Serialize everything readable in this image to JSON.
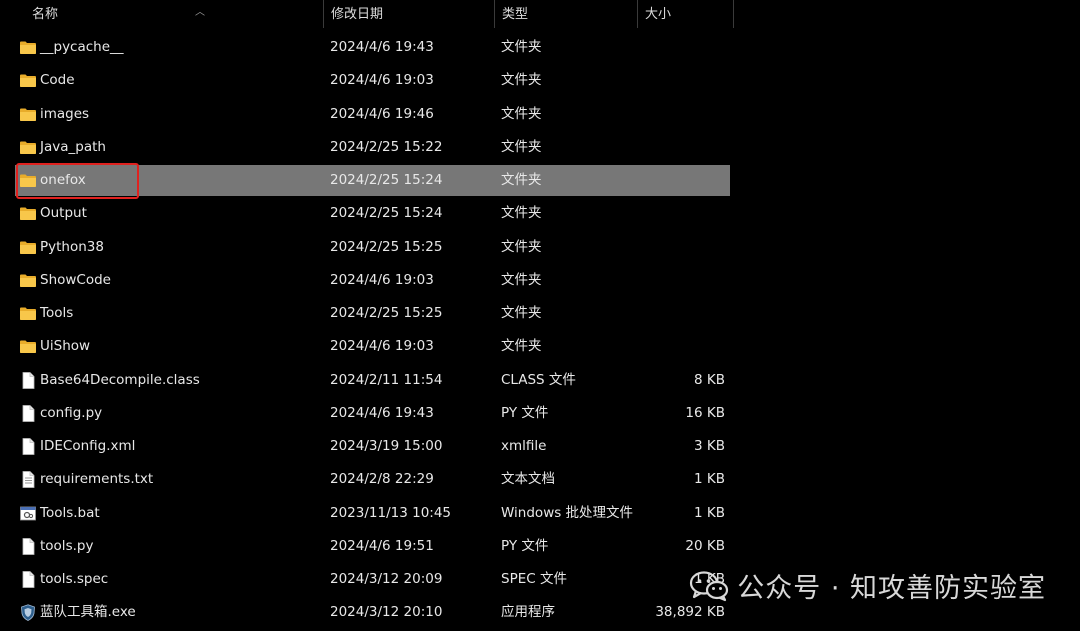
{
  "columns": {
    "name": "名称",
    "date": "修改日期",
    "type": "类型",
    "size": "大小"
  },
  "rows": [
    {
      "name": "__pycache__",
      "date": "2024/4/6 19:43",
      "type": "文件夹",
      "size": "",
      "icon": "folder-icon"
    },
    {
      "name": "Code",
      "date": "2024/4/6 19:03",
      "type": "文件夹",
      "size": "",
      "icon": "folder-icon"
    },
    {
      "name": "images",
      "date": "2024/4/6 19:46",
      "type": "文件夹",
      "size": "",
      "icon": "folder-icon"
    },
    {
      "name": "Java_path",
      "date": "2024/2/25 15:22",
      "type": "文件夹",
      "size": "",
      "icon": "folder-icon"
    },
    {
      "name": "onefox",
      "date": "2024/2/25 15:24",
      "type": "文件夹",
      "size": "",
      "icon": "folder-icon",
      "selected": true
    },
    {
      "name": "Output",
      "date": "2024/2/25 15:24",
      "type": "文件夹",
      "size": "",
      "icon": "folder-icon"
    },
    {
      "name": "Python38",
      "date": "2024/2/25 15:25",
      "type": "文件夹",
      "size": "",
      "icon": "folder-icon"
    },
    {
      "name": "ShowCode",
      "date": "2024/4/6 19:03",
      "type": "文件夹",
      "size": "",
      "icon": "folder-icon"
    },
    {
      "name": "Tools",
      "date": "2024/2/25 15:25",
      "type": "文件夹",
      "size": "",
      "icon": "folder-icon"
    },
    {
      "name": "UiShow",
      "date": "2024/4/6 19:03",
      "type": "文件夹",
      "size": "",
      "icon": "folder-icon"
    },
    {
      "name": "Base64Decompile.class",
      "date": "2024/2/11 11:54",
      "type": "CLASS 文件",
      "size": "8 KB",
      "icon": "file-icon"
    },
    {
      "name": "config.py",
      "date": "2024/4/6 19:43",
      "type": "PY 文件",
      "size": "16 KB",
      "icon": "file-icon"
    },
    {
      "name": "IDEConfig.xml",
      "date": "2024/3/19 15:00",
      "type": "xmlfile",
      "size": "3 KB",
      "icon": "file-icon"
    },
    {
      "name": "requirements.txt",
      "date": "2024/2/8 22:29",
      "type": "文本文档",
      "size": "1 KB",
      "icon": "text-file-icon"
    },
    {
      "name": "Tools.bat",
      "date": "2023/11/13 10:45",
      "type": "Windows 批处理文件",
      "size": "1 KB",
      "icon": "batch-file-icon"
    },
    {
      "name": "tools.py",
      "date": "2024/4/6 19:51",
      "type": "PY 文件",
      "size": "20 KB",
      "icon": "file-icon"
    },
    {
      "name": "tools.spec",
      "date": "2024/3/12 20:09",
      "type": "SPEC 文件",
      "size": "1 KB",
      "icon": "file-icon"
    },
    {
      "name": "蓝队工具箱.exe",
      "date": "2024/3/12 20:10",
      "type": "应用程序",
      "size": "38,892 KB",
      "icon": "exe-shield-icon"
    }
  ],
  "watermark": {
    "text": "公众号 · 知攻善防实验室",
    "icon": "wechat-icon"
  },
  "colors": {
    "selection": "#777777",
    "highlight_box": "#e0221f",
    "folder": "#f8c74a"
  }
}
